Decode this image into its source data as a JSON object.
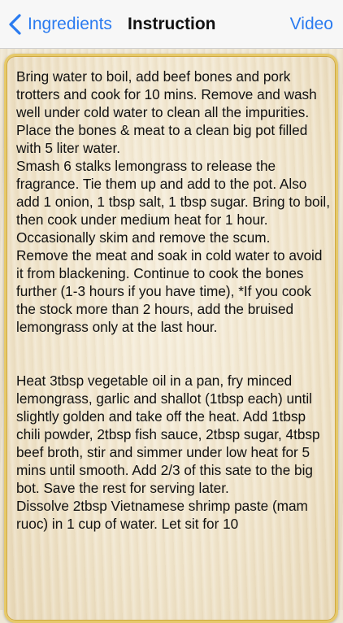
{
  "navbar": {
    "back_label": "Ingredients",
    "title": "Instruction",
    "right_label": "Video",
    "accent_color": "#2a7bf0"
  },
  "instructions": {
    "section1": [
      "Bring water to boil, add beef bones and pork trotters and cook for 10 mins. Remove and wash well under cold water to clean all the impurities.",
      "Place the bones & meat to a clean big pot filled with 5 liter water.",
      "Smash 6 stalks lemongrass to release the fragrance. Tie them up and add to the pot. Also add 1 onion, 1 tbsp salt, 1 tbsp sugar. Bring to boil, then cook under medium heat for 1 hour. Occasionally skim and remove the scum.",
      "Remove the meat and soak in cold water to avoid it from blackening. Continue to cook the bones further (1-3 hours if you have time), *If you cook the stock more than 2 hours, add the bruised lemongrass only at the last hour."
    ],
    "section2": [
      "Heat 3tbsp vegetable oil in a pan, fry minced lemongrass, garlic and shallot (1tbsp each) until slightly golden and take off the heat. Add 1tbsp chili powder, 2tbsp fish sauce, 2tbsp sugar, 4tbsp beef broth, stir and simmer under low heat for 5 mins until smooth. Add 2/3 of this sate to the big bot. Save the rest for serving later.",
      "Dissolve 2tbsp Vietnamese shrimp paste (mam ruoc) in 1 cup of water. Let sit for 10"
    ]
  }
}
